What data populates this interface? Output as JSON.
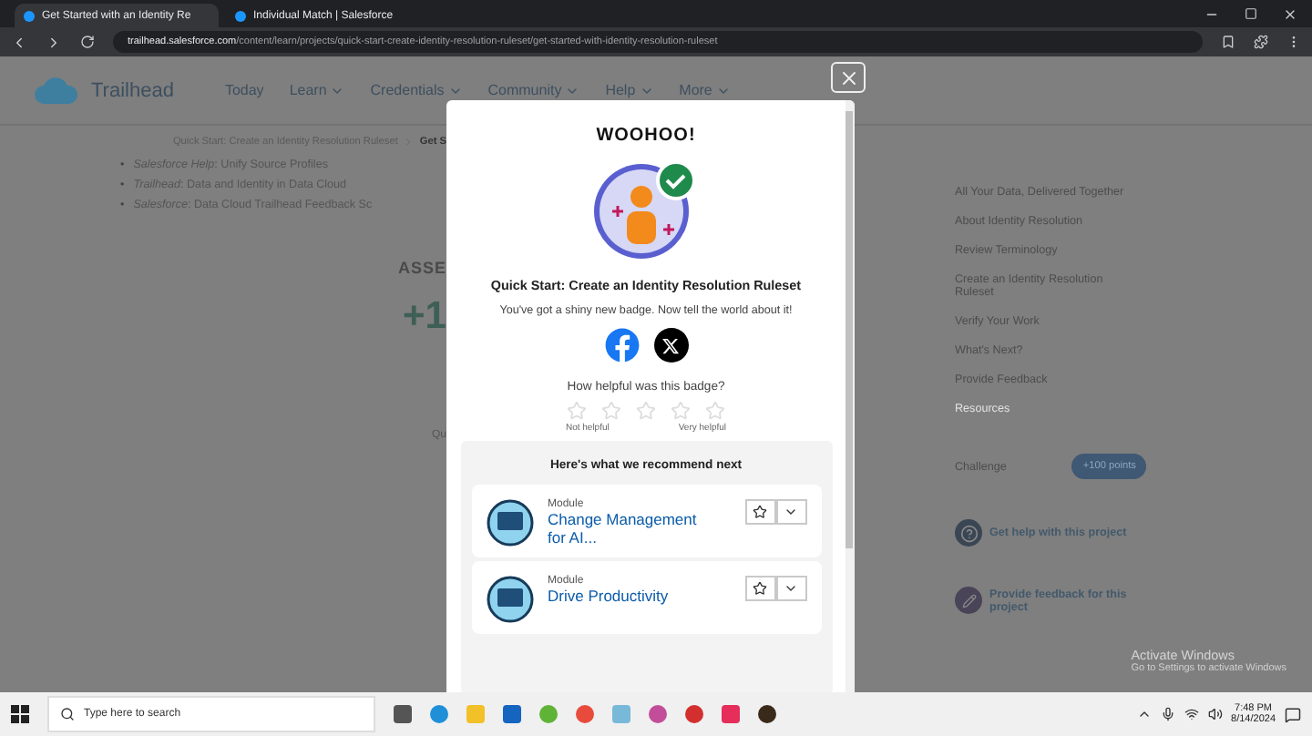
{
  "browser": {
    "tabs": [
      {
        "title": "Get Started with an Identity Re",
        "selected": true
      },
      {
        "title": "Individual Match | Salesforce",
        "selected": false
      }
    ],
    "url_host": "trailhead.salesforce.com",
    "url_path": "/content/learn/projects/quick-start-create-identity-resolution-ruleset/get-started-with-identity-resolution-ruleset"
  },
  "nav": {
    "logo": "Trailhead",
    "items": [
      {
        "label": "Today",
        "dropdown": false
      },
      {
        "label": "Learn",
        "dropdown": true
      },
      {
        "label": "Credentials",
        "dropdown": true
      },
      {
        "label": "Community",
        "dropdown": true
      },
      {
        "label": "Help",
        "dropdown": true
      },
      {
        "label": "More",
        "dropdown": true
      }
    ]
  },
  "breadcrumb": [
    "Quick Start: Create an Identity Resolution Ruleset",
    "Get S"
  ],
  "resources": [
    {
      "marker": "•",
      "text": "*Salesforce Help*: Unify Source Profiles"
    },
    {
      "marker": "•",
      "text": "*Trailhead*: Data and Identity in Data Cloud"
    },
    {
      "marker": "•",
      "text": "*Salesforce*: Data Cloud Trailhead Feedback Sc"
    }
  ],
  "assessment": {
    "heading": "ASSE",
    "points": "+1",
    "caption": "Qu"
  },
  "sidebar": {
    "items": [
      {
        "label": "All Your Data, Delivered Together",
        "selected": false
      },
      {
        "label": "About Identity Resolution",
        "selected": false
      },
      {
        "label": "Review Terminology",
        "selected": false
      },
      {
        "label": "Create an Identity Resolution Ruleset",
        "selected": false
      },
      {
        "label": "Verify Your Work",
        "selected": false
      },
      {
        "label": "What's Next?",
        "selected": false
      },
      {
        "label": "Provide Feedback",
        "selected": false
      },
      {
        "label": "Resources",
        "selected": true
      }
    ],
    "challenge": {
      "label": "Challenge",
      "points": "+100 points"
    },
    "links": [
      {
        "kind": "help",
        "label": "Get help with this project"
      },
      {
        "kind": "feedback",
        "label": "Provide feedback for this project"
      }
    ]
  },
  "modal": {
    "heading": "WOOHOO!",
    "badge_title": "Quick Start: Create an Identity Resolution Ruleset",
    "message": "You've got a shiny new badge. Now tell the world about it!",
    "rating": {
      "question": "How helpful was this badge?",
      "stars": 0,
      "low_label": "Not helpful",
      "high_label": "Very helpful"
    },
    "recommend": {
      "heading": "Here's what we recommend next",
      "items": [
        {
          "type": "Module",
          "title": "Change Management for AI..."
        },
        {
          "type": "Module",
          "title": "Drive Productivity"
        }
      ]
    }
  },
  "os": {
    "activation": [
      "Activate Windows",
      "Go to Settings to activate Windows"
    ],
    "search_placeholder": "Type here to search",
    "time": "7:48 PM",
    "date": "8/14/2024"
  }
}
